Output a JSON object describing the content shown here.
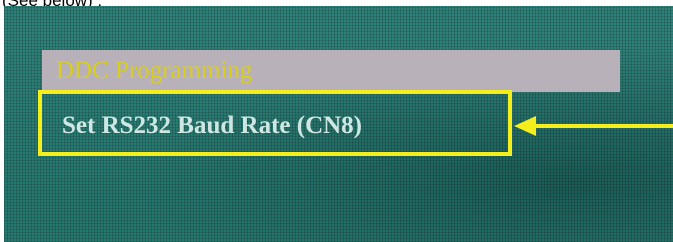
{
  "caption": {
    "text": "(See below) :"
  },
  "menu": {
    "items": [
      {
        "label": "DDC Programming",
        "highlighted": true
      },
      {
        "label": "Set RS232 Baud Rate (CN8)",
        "highlighted": false
      }
    ]
  },
  "colors": {
    "screen_background": "#2f8079",
    "highlight_bar": "#b9b1ba",
    "highlight_text": "#d8cf1c",
    "item_text": "#cfe7e2",
    "callout": "#f3ee1c"
  }
}
